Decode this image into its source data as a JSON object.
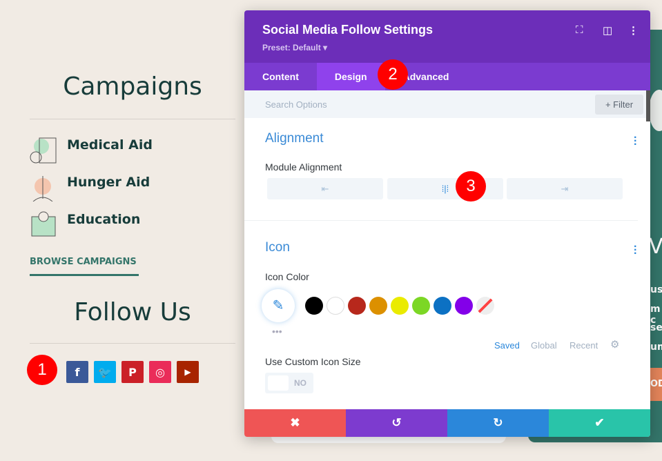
{
  "page": {
    "campaigns_title": "Campaigns",
    "campaigns": [
      {
        "label": "Medical Aid",
        "icon": "medicine-bottle-icon"
      },
      {
        "label": "Hunger Aid",
        "icon": "plant-icon"
      },
      {
        "label": "Education",
        "icon": "book-lightbulb-icon"
      }
    ],
    "browse_link": "BROWSE CAMPAIGNS",
    "follow_title": "Follow Us",
    "social": [
      {
        "name": "facebook",
        "glyph": "f",
        "color": "#3b5998"
      },
      {
        "name": "twitter",
        "glyph": "🐦",
        "color": "#00acee"
      },
      {
        "name": "pinterest",
        "glyph": "P",
        "color": "#cb2027"
      },
      {
        "name": "instagram",
        "glyph": "◎",
        "color": "#ea2c59"
      },
      {
        "name": "youtube",
        "glyph": "▶",
        "color": "#a82400"
      }
    ],
    "right_panel_text": [
      "VO",
      "us",
      "m c",
      "ser",
      "um"
    ],
    "right_button": "ODA"
  },
  "badges": [
    "1",
    "2",
    "3"
  ],
  "modal": {
    "title": "Social Media Follow Settings",
    "preset": "Preset: Default ▾",
    "tabs": [
      "Content",
      "Design",
      "Advanced"
    ],
    "active_tab": "Design",
    "search_placeholder": "Search Options",
    "filter": "+ Filter",
    "alignment": {
      "title": "Alignment",
      "label": "Module Alignment",
      "options": [
        "left",
        "center",
        "right"
      ],
      "selected": "center"
    },
    "icon": {
      "title": "Icon",
      "color_label": "Icon Color",
      "swatches": [
        "#000000",
        "#ffffff",
        "#b7281c",
        "#dc9000",
        "#eaeb00",
        "#7cd725",
        "#0c71c3",
        "#8300e9"
      ],
      "palette_tabs": [
        "Saved",
        "Global",
        "Recent"
      ],
      "active_palette": "Saved",
      "custom_size_label": "Use Custom Icon Size",
      "toggle": "NO"
    },
    "footer": {
      "colors": [
        "#ef5555",
        "#7d3bcf",
        "#2b87da",
        "#29c4a9"
      ]
    }
  }
}
